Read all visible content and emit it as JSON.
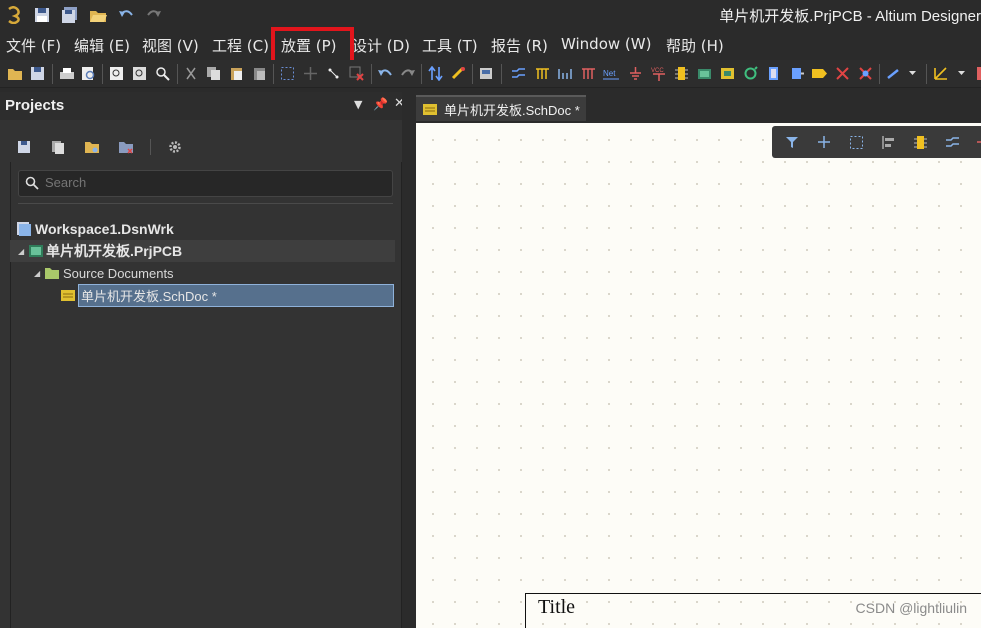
{
  "window": {
    "title": "单片机开发板.PrjPCB - Altium Designer"
  },
  "quick_access": [
    "app-logo-icon",
    "save-icon",
    "save-all-icon",
    "open-folder-icon",
    "undo-icon",
    "redo-icon"
  ],
  "menu": {
    "items": [
      {
        "label": "文件 (F)"
      },
      {
        "label": "编辑 (E)"
      },
      {
        "label": "视图 (V)"
      },
      {
        "label": "工程 (C)"
      },
      {
        "label": "放置 (P)"
      },
      {
        "label": "设计 (D)"
      },
      {
        "label": "工具 (T)"
      },
      {
        "label": "报告 (R)"
      },
      {
        "label": "Window (W)"
      },
      {
        "label": "帮助 (H)"
      }
    ],
    "highlighted_item": "放置 (P)",
    "highlight_color": "#e2151c"
  },
  "projects_panel": {
    "title": "Projects",
    "search_placeholder": "Search",
    "tree": {
      "workspace": "Workspace1.DsnWrk",
      "project": "单片机开发板.PrjPCB",
      "folder": "Source Documents",
      "document": "单片机开发板.SchDoc *"
    }
  },
  "document_tab": {
    "label": "单片机开发板.SchDoc *"
  },
  "sheet": {
    "title_block_label": "Title",
    "background_color": "#fdfcf7"
  },
  "watermark": "CSDN @lightliulin",
  "colors": {
    "chrome_bg": "#2b2b2b",
    "panel_bg": "#333333",
    "selection": "#56708d"
  }
}
